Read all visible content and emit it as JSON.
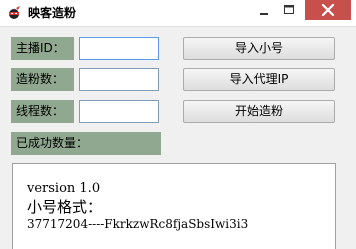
{
  "window": {
    "title": "映客造粉",
    "icon": "ninja-icon",
    "controls": [
      "minimize-icon",
      "maximize-icon",
      "close-icon"
    ]
  },
  "fields": [
    {
      "label": "主播ID：",
      "value": ""
    },
    {
      "label": "造粉数：",
      "value": ""
    },
    {
      "label": "线程数：",
      "value": ""
    }
  ],
  "buttons": {
    "import_accounts": "导入小号",
    "import_proxy": "导入代理IP",
    "start": "开始造粉"
  },
  "success_count": {
    "label": "已成功数量："
  },
  "log": {
    "lines": [
      "version 1.0",
      "小号格式：",
      "37717204----FkrkzwRc8fjaSbsIwi3i3"
    ]
  },
  "colors": {
    "label_bg": "#8fa88f",
    "close_button": "#c7504d",
    "input_focus_border": "#569de5"
  }
}
